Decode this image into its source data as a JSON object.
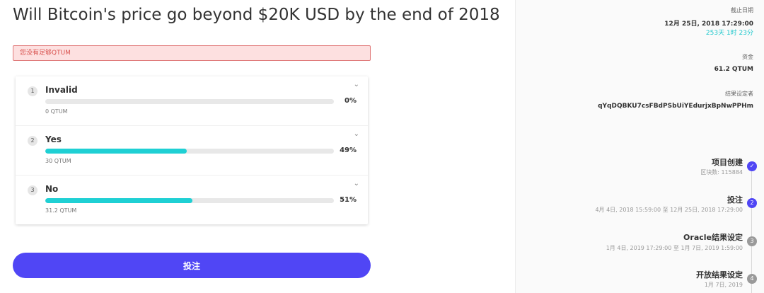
{
  "topic": {
    "title": "Will Bitcoin's price go beyond $20K USD by the end of 2018"
  },
  "alert": {
    "message": "您没有足够QTUM"
  },
  "options": [
    {
      "number": "1",
      "name": "Invalid",
      "percent_label": "0%",
      "percent": 0,
      "amount": "0 QTUM"
    },
    {
      "number": "2",
      "name": "Yes",
      "percent_label": "49%",
      "percent": 49,
      "amount": "30 QTUM"
    },
    {
      "number": "3",
      "name": "No",
      "percent_label": "51%",
      "percent": 51,
      "amount": "31.2 QTUM"
    }
  ],
  "bet_button": {
    "label": "投注"
  },
  "info": {
    "deadline_label": "截止日期",
    "deadline_value": "12月 25日, 2018 17:29:00",
    "deadline_remaining": "253天 1时 23分",
    "funds_label": "资金",
    "funds_value": "61.2 QTUM",
    "oracle_label": "结果设定者",
    "oracle_value": "qYqDQBKU7csFBdPSbUiYEdurjxBpNwPPHm"
  },
  "timeline": [
    {
      "marker": "✓",
      "title": "项目创建",
      "sub": "区块数: 115884",
      "state": "done"
    },
    {
      "marker": "2",
      "title": "投注",
      "sub": "4月 4日, 2018 15:59:00 至 12月 25日, 2018 17:29:00",
      "state": "active"
    },
    {
      "marker": "3",
      "title": "Oracle结果设定",
      "sub": "1月 4日, 2019 17:29:00 至 1月 7日, 2019 1:59:00",
      "state": "pending"
    },
    {
      "marker": "4",
      "title": "开放结果设定",
      "sub": "1月 7日, 2019",
      "state": "pending"
    }
  ],
  "colors": {
    "accent": "#5046f5",
    "progress": "#1fd0d4",
    "alert_bg": "#fde0e0",
    "alert_border": "#e07a7a",
    "alert_text": "#d9534f",
    "timeline_done": "#5046f5",
    "timeline_pending": "#9a9a9a"
  }
}
